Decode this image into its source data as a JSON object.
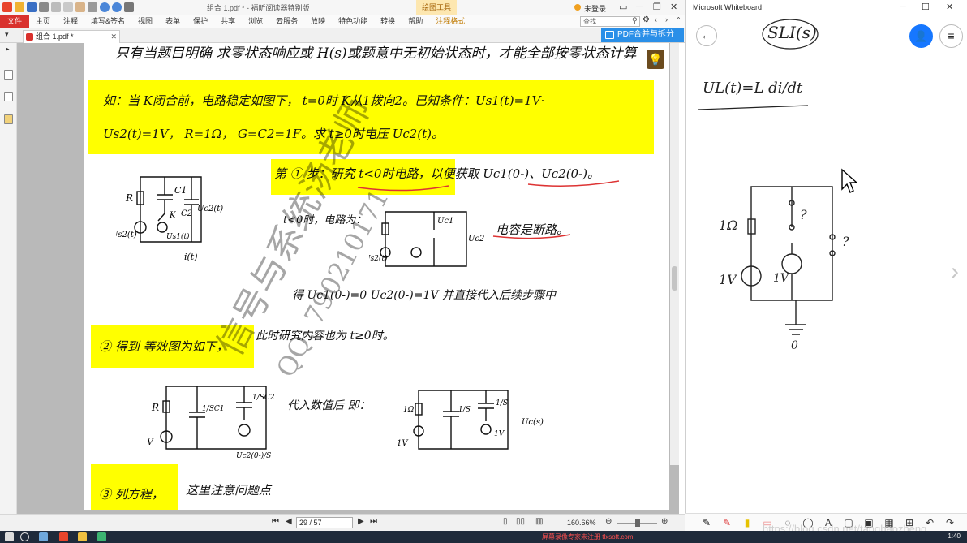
{
  "pdf": {
    "window_title": "组合 1.pdf * - 福昕阅读器特别版",
    "context_tab": "绘图工具",
    "login": "未登录",
    "file_tab": "文件",
    "menu": [
      "主页",
      "注释",
      "填写&签名",
      "视图",
      "表单",
      "保护",
      "共享",
      "浏览",
      "云服务",
      "放映",
      "特色功能",
      "转换",
      "帮助",
      "注释格式"
    ],
    "search_placeholder": "查找",
    "doc_tab": "组合 1.pdf *",
    "merge_button": "PDF合并与拆分",
    "page_indicator": "29 / 57",
    "zoom": "160.66%",
    "page_lines": [
      "只有当题目明确 求零状态响应或 H(s)或题意中无初始状态时，才能全部按零状态计算",
      "如：当 K闭合前，电路稳定如图下，  t=0时 K从1拨向2。已知条件：Us1(t)=1V·",
      "Us2(t)=1V， R=1Ω， G=C2=1F。求 t≥0时电压 Uc2(t)。",
      "第 ① 步：研究 t<0时电路，以便获取 Uc1(0-)、Uc2(0-)。",
      "t<0时，电路为：",
      "电容是断路。",
      "得 Uc1(0-)=0    Uc2(0-)=1V  并直接代入后续步骤中",
      "② 得到 等效图为如下，",
      "此时研究内容也为 t≥0时。",
      "代入数值后 即：",
      "③ 列方程，",
      "这里注意问题点"
    ],
    "circuit_labels": [
      "R",
      "C1",
      "C2",
      "K",
      "Us1(t)",
      "Us2(t)",
      "Uc2(t)",
      "i(t)",
      "Uc1",
      "Uc2",
      "1Ω",
      "1V",
      "Uc2(0-)/S",
      "1/SC1",
      "1/SC2",
      "Uc(s)",
      "1/S",
      "1/S"
    ],
    "watermark_lines": [
      "信号与系统汤老师",
      "QQ: 790210171"
    ]
  },
  "whiteboard": {
    "title": "Microsoft Whiteboard",
    "ink_top": "SLI(s)",
    "ink_formula": "UL(t)=L di/dt",
    "ink_labels": [
      "1Ω",
      "1V",
      "1V",
      "?",
      "?",
      "0"
    ],
    "tools": [
      "pen-black",
      "pen-red",
      "highlighter",
      "eraser",
      "lasso",
      "shape",
      "text",
      "note",
      "image",
      "table",
      "add",
      "undo",
      "redo"
    ]
  },
  "url_watermark": "https://blog.csdn.net/tangbaozheng",
  "taskbar": {
    "ad_text": "屏幕录像专家未注册 tlxsoft.com",
    "clock": "1:40"
  }
}
